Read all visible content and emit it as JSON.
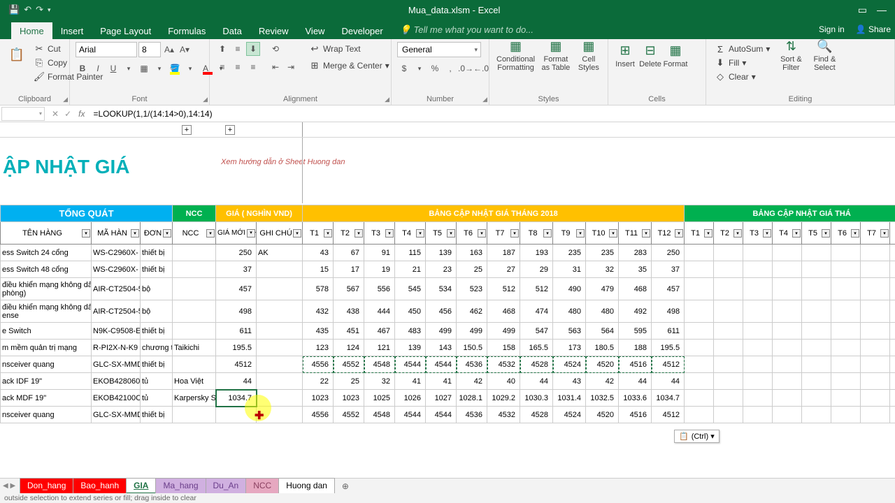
{
  "title": "Mua_data.xlsm - Excel",
  "tabs": [
    "Home",
    "Insert",
    "Page Layout",
    "Formulas",
    "Data",
    "Review",
    "View",
    "Developer"
  ],
  "tellme": "Tell me what you want to do...",
  "signin": "Sign in",
  "share": "Share",
  "clipboard": {
    "label": "Clipboard",
    "cut": "Cut",
    "copy": "Copy",
    "fp": "Format Painter"
  },
  "font": {
    "label": "Font",
    "name": "Arial",
    "size": "8"
  },
  "alignment": {
    "label": "Alignment",
    "wrap": "Wrap Text",
    "merge": "Merge & Center"
  },
  "number": {
    "label": "Number",
    "format": "General"
  },
  "styles": {
    "label": "Styles",
    "cf": "Conditional Formatting",
    "fat": "Format as Table",
    "cs": "Cell Styles"
  },
  "cells": {
    "label": "Cells",
    "ins": "Insert",
    "del": "Delete",
    "fmt": "Format"
  },
  "editing": {
    "label": "Editing",
    "autosum": "AutoSum",
    "fill": "Fill",
    "clear": "Clear",
    "sort": "Sort & Filter",
    "find": "Find & Select"
  },
  "formula": "=LOOKUP(1,1/(14:14>0),14:14)",
  "big_title": "ẬP NHẬT GIÁ",
  "hint": "Xem hướng dẫn ở\nSheet Huong dan",
  "section_headers": {
    "tq": "TỔNG QUÁT",
    "ncc": "NCC",
    "gia": "GIÁ ( NGHÌN VND)",
    "bcn1": "BẢNG CẬP NHẬT GIÁ THÁNG 2018",
    "bcn2": "BẢNG CẬP NHẬT GIÁ THÁ"
  },
  "col_headers": {
    "ten": "TÊN HÀNG",
    "ma": "MÃ HÀN",
    "don": "ĐƠN",
    "ncc": "NCC",
    "gia_moi": "GIÁ MỚI NHẤT",
    "ghi": "GHI CHÚ",
    "months": [
      "T1",
      "T2",
      "T3",
      "T4",
      "T5",
      "T6",
      "T7",
      "T8",
      "T9",
      "T10",
      "T11",
      "T12"
    ],
    "months2": [
      "T1",
      "T2",
      "T3",
      "T4",
      "T5",
      "T6",
      "T7",
      "T8"
    ]
  },
  "rows": [
    {
      "ten": "ess Switch 24 cổng",
      "ma": "WS-C2960X-",
      "don": "thiết bị",
      "ncc": "",
      "gia": "250",
      "ghi": "AK",
      "m": [
        "43",
        "67",
        "91",
        "115",
        "139",
        "163",
        "187",
        "193",
        "235",
        "235",
        "283",
        "250"
      ]
    },
    {
      "ten": "ess Switch 48 cổng",
      "ma": "WS-C2960X-",
      "don": "thiết bị",
      "ncc": "",
      "gia": "37",
      "ghi": "",
      "m": [
        "15",
        "17",
        "19",
        "21",
        "23",
        "25",
        "27",
        "29",
        "31",
        "32",
        "35",
        "37"
      ]
    },
    {
      "ten": "điều khiển mạng không dây\nphòng)",
      "ma": "AIR-CT2504-5",
      "don": "bộ",
      "ncc": "",
      "gia": "457",
      "ghi": "",
      "m": [
        "578",
        "567",
        "556",
        "545",
        "534",
        "523",
        "512",
        "512",
        "490",
        "479",
        "468",
        "457"
      ]
    },
    {
      "ten": "điều khiển mạng không dây\nense",
      "ma": "AIR-CT2504-5",
      "don": "bộ",
      "ncc": "",
      "gia": "498",
      "ghi": "",
      "m": [
        "432",
        "438",
        "444",
        "450",
        "456",
        "462",
        "468",
        "474",
        "480",
        "480",
        "492",
        "498"
      ]
    },
    {
      "ten": "e Switch",
      "ma": "N9K-C9508-E",
      "don": "thiết bị",
      "ncc": "",
      "gia": "611",
      "ghi": "",
      "m": [
        "435",
        "451",
        "467",
        "483",
        "499",
        "499",
        "499",
        "547",
        "563",
        "564",
        "595",
        "611"
      ]
    },
    {
      "ten": "m mềm quản trị mạng",
      "ma": "R-PI2X-N-K9",
      "don": "chương tr",
      "ncc": "Taikichi",
      "gia": "195.5",
      "ghi": "",
      "m": [
        "123",
        "124",
        "121",
        "139",
        "143",
        "150.5",
        "158",
        "165.5",
        "173",
        "180.5",
        "188",
        "195.5"
      ]
    },
    {
      "ten": "nsceiver quang",
      "ma": "GLC-SX-MMD",
      "don": "thiết bị",
      "ncc": "",
      "gia": "4512",
      "ghi": "",
      "m": [
        "4556",
        "4552",
        "4548",
        "4544",
        "4544",
        "4536",
        "4532",
        "4528",
        "4524",
        "4520",
        "4516",
        "4512"
      ]
    },
    {
      "ten": "ack IDF 19\"",
      "ma": "EKOB428060",
      "don": "tủ",
      "ncc": "Hoa Việt",
      "gia": "44",
      "ghi": "",
      "m": [
        "22",
        "25",
        "32",
        "41",
        "41",
        "42",
        "40",
        "44",
        "43",
        "42",
        "44",
        "44"
      ]
    },
    {
      "ten": "ack MDF 19\"",
      "ma": "EKOB42100C",
      "don": "tủ",
      "ncc": "Karpersky S",
      "gia": "1034.7",
      "ghi": "",
      "m": [
        "1023",
        "1023",
        "1025",
        "1026",
        "1027",
        "1028.1",
        "1029.2",
        "1030.3",
        "1031.4",
        "1032.5",
        "1033.6",
        "1034.7"
      ]
    },
    {
      "ten": "nsceiver quang",
      "ma": "GLC-SX-MMD",
      "don": "thiết bị",
      "ncc": "",
      "gia": "",
      "ghi": "",
      "m": [
        "4556",
        "4552",
        "4548",
        "4544",
        "4544",
        "4536",
        "4532",
        "4528",
        "4524",
        "4520",
        "4516",
        "4512"
      ]
    }
  ],
  "paste_opt": "(Ctrl) ▾",
  "sheet_tabs": [
    {
      "name": "Don_hang",
      "cls": "red"
    },
    {
      "name": "Bao_hanh",
      "cls": "red"
    },
    {
      "name": "GIA",
      "cls": "active"
    },
    {
      "name": "Ma_hang",
      "cls": "purple"
    },
    {
      "name": "Du_An",
      "cls": "purple"
    },
    {
      "name": "NCC",
      "cls": "pink"
    },
    {
      "name": "Huong dan",
      "cls": "black"
    }
  ],
  "status": "outside selection to extend series or fill; drag inside to clear"
}
